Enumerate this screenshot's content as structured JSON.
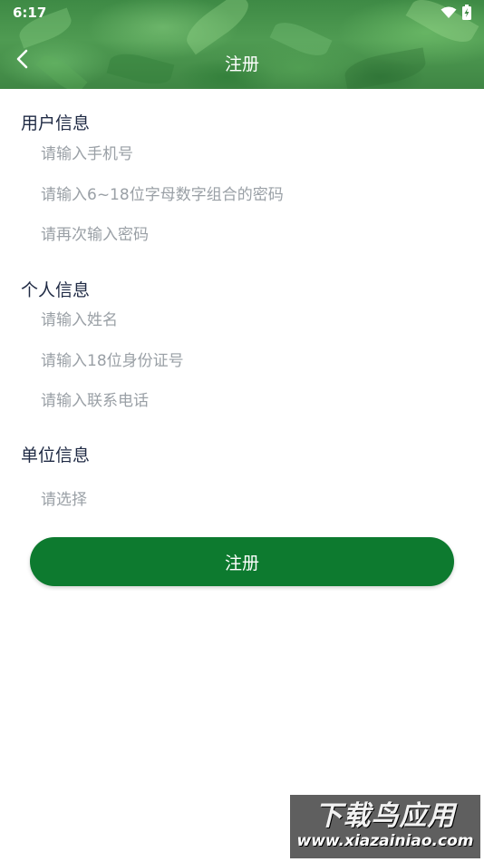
{
  "status_bar": {
    "time": "6:17"
  },
  "header": {
    "title": "注册"
  },
  "sections": {
    "user_info": {
      "title": "用户信息",
      "phone_placeholder": "请输入手机号",
      "password_placeholder": "请输入6~18位字母数字组合的密码",
      "password_confirm_placeholder": "请再次输入密码"
    },
    "personal_info": {
      "title": "个人信息",
      "name_placeholder": "请输入姓名",
      "id_placeholder": "请输入18位身份证号",
      "contact_placeholder": "请输入联系电话"
    },
    "unit_info": {
      "title": "单位信息",
      "select_placeholder": "请选择"
    }
  },
  "register_button": {
    "label": "注册"
  },
  "watermark": {
    "brand": "下载鸟应用",
    "url": "www.xiazainiao.com"
  },
  "colors": {
    "accent": "#0d7a2f",
    "placeholder": "#9aa0a6",
    "header_green": "#4f9b52"
  },
  "icons": [
    "wifi-icon",
    "battery-icon",
    "back-arrow-icon"
  ]
}
